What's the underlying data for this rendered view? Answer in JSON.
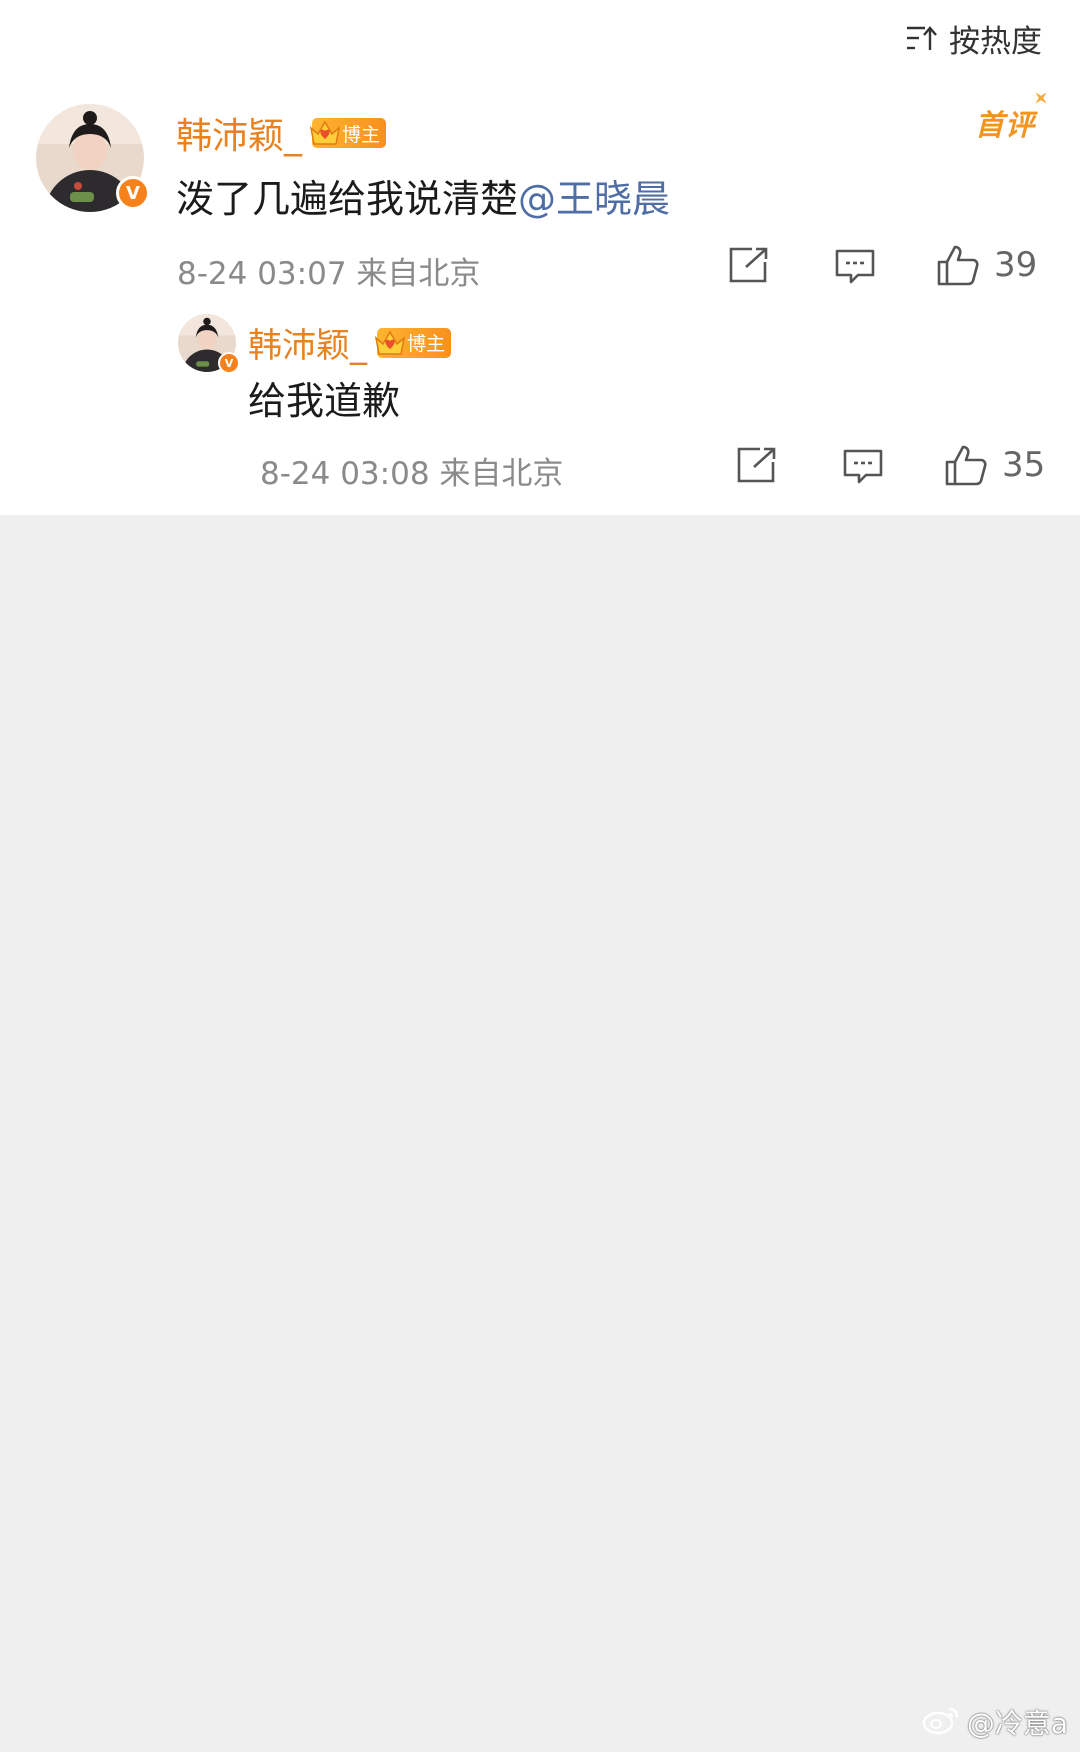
{
  "sort": {
    "label": "按热度",
    "icon": "sort-icon"
  },
  "comment": {
    "username": "韩沛颖_",
    "tag": "博主",
    "badge": "首评",
    "text": "泼了几遍给我说清楚",
    "mention": "@王晓晨",
    "time": "8-24 03:07",
    "location": "来自北京",
    "likes": "39"
  },
  "reply": {
    "username": "韩沛颖_",
    "tag": "博主",
    "text": "给我道歉",
    "time": "8-24 03:08",
    "location": "来自北京",
    "likes": "35"
  },
  "watermark": {
    "text": "@冷意a",
    "icon": "weibo-logo-icon"
  },
  "colors": {
    "username": "#e8821e",
    "mention": "#4f6ea6",
    "verified": "#f7821b",
    "background": "#efefef"
  }
}
